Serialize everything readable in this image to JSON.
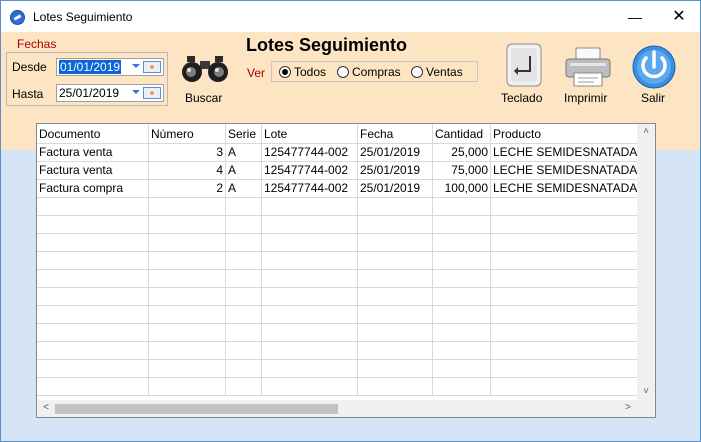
{
  "window": {
    "title": "Lotes Seguimiento"
  },
  "form": {
    "heading": "Lotes Seguimiento",
    "fechas_label": "Fechas",
    "desde_label": "Desde",
    "desde_value": "01/01/2019",
    "hasta_label": "Hasta",
    "hasta_value": "25/01/2019",
    "buscar_label": "Buscar",
    "ver_label": "Ver",
    "radios": [
      {
        "label": "Todos",
        "selected": true
      },
      {
        "label": "Compras",
        "selected": false
      },
      {
        "label": "Ventas",
        "selected": false
      }
    ]
  },
  "toolbar": {
    "teclado_label": "Teclado",
    "imprimir_label": "Imprimir",
    "salir_label": "Salir"
  },
  "colors": {
    "toolbar_bg": "#fde5c3",
    "body_bg": "#d5e5f5",
    "selection": "#0a64d6",
    "label_red": "#b00000"
  },
  "table": {
    "columns": [
      "Documento",
      "Número",
      "Serie",
      "Lote",
      "Fecha",
      "Cantidad",
      "Producto"
    ],
    "rows": [
      [
        "Factura venta",
        "3",
        "A",
        "125477744-002",
        "25/01/2019",
        "25,000",
        "LECHE SEMIDESNATADA"
      ],
      [
        "Factura venta",
        "4",
        "A",
        "125477744-002",
        "25/01/2019",
        "75,000",
        "LECHE SEMIDESNATADA"
      ],
      [
        "Factura compra",
        "2",
        "A",
        "125477744-002",
        "25/01/2019",
        "100,000",
        "LECHE SEMIDESNATADA"
      ]
    ]
  }
}
